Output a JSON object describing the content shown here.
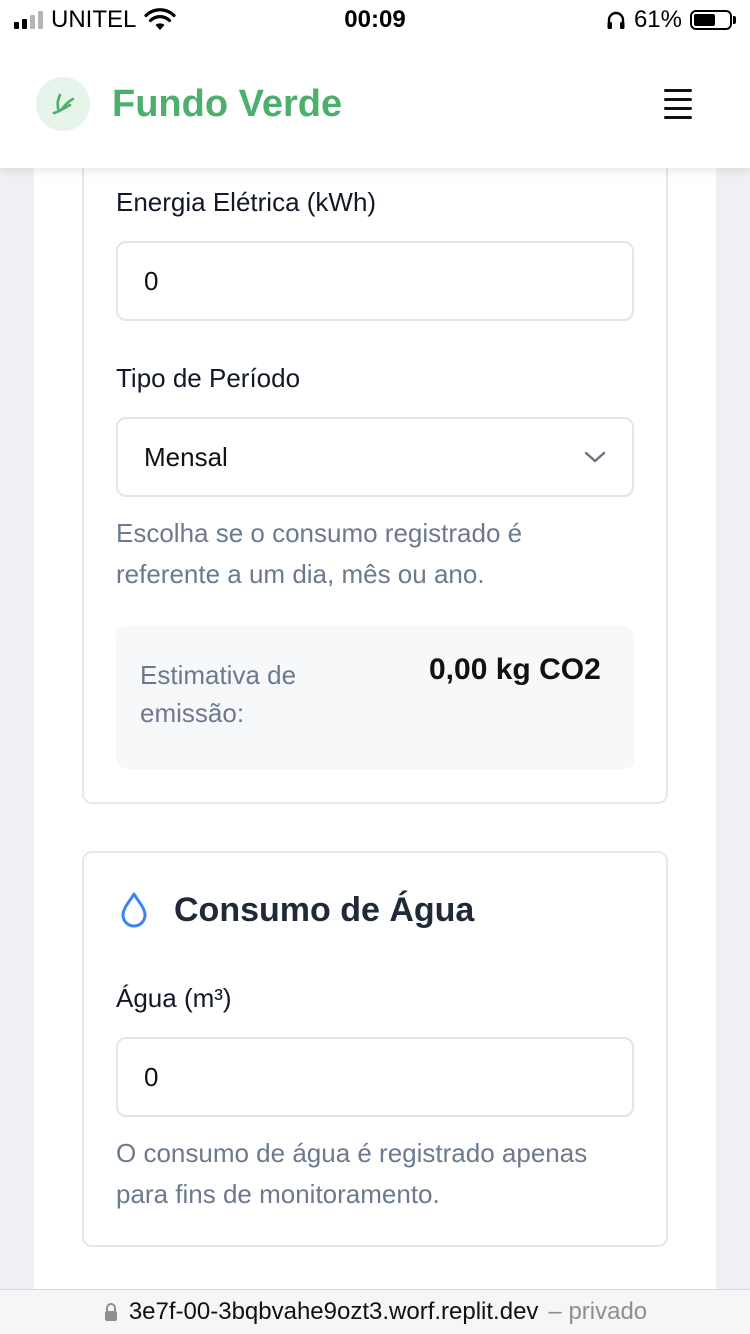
{
  "status_bar": {
    "carrier": "UNITEL",
    "time": "00:09",
    "battery": "61%",
    "battery_level": 0.61,
    "icons": [
      "signal-icon",
      "wifi-icon",
      "headphones-icon",
      "battery-icon"
    ]
  },
  "header": {
    "brand": "Fundo Verde",
    "brand_color": "#4caf6e",
    "logo_icon": "leaf-icon",
    "menu_icon": "hamburger-menu-icon"
  },
  "energy": {
    "kwh_label": "Energia Elétrica (kWh)",
    "kwh_value": "0",
    "period_label": "Tipo de Período",
    "period_value": "Mensal",
    "period_help": "Escolha se o consumo registrado é referente a um dia, mês ou ano.",
    "estimate_label": "Estimativa de emissão:",
    "estimate_value": "0,00 kg CO2"
  },
  "water": {
    "title": "Consumo de Água",
    "title_icon": "water-drop-icon",
    "water_label": "Água (m³)",
    "water_value": "0",
    "water_help": "O consumo de água é registrado apenas para fins de monitoramento."
  },
  "url_bar": {
    "url": "3e7f-00-3bqbvahe9ozt3.worf.replit.dev",
    "suffix": "– privado",
    "lock_icon": "lock-icon"
  }
}
